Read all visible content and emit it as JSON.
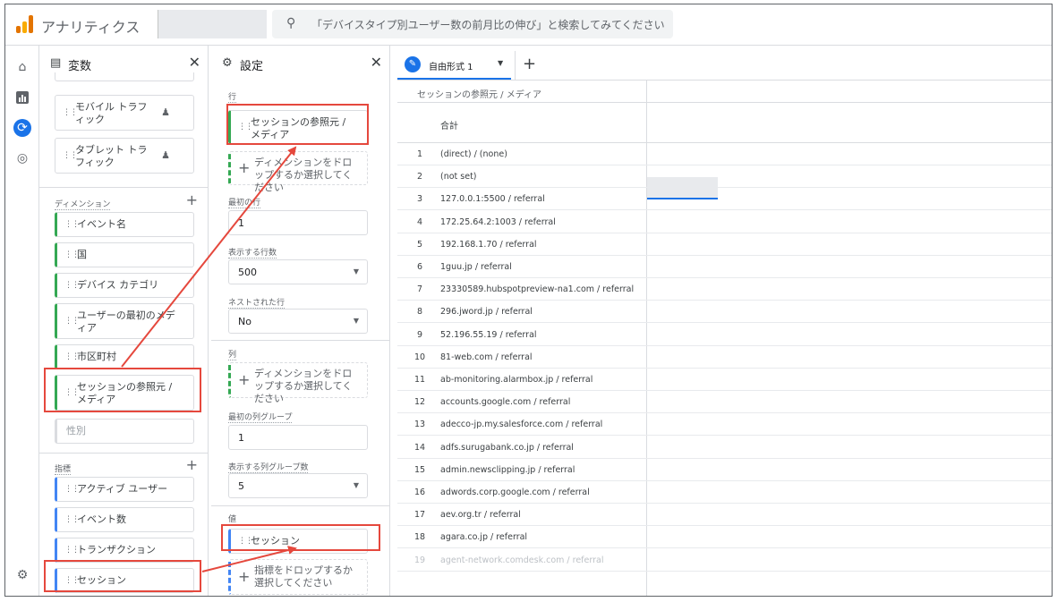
{
  "header": {
    "app_title": "アナリティクス",
    "search_placeholder": "「デバイスタイプ別ユーザー数の前月比の伸び」と検索してみてください"
  },
  "rail": {
    "icons": [
      "home-icon",
      "reports-icon",
      "explore-icon",
      "advertising-icon",
      "settings-icon"
    ]
  },
  "variables_panel": {
    "title": "変数",
    "top_chips": [
      "モバイル トラフィック",
      "タブレット トラフィック"
    ],
    "dimensions_label": "ディメンション",
    "dimensions": [
      "イベント名",
      "国",
      "デバイス カテゴリ",
      "ユーザーの最初のメディア",
      "市区町村",
      "セッションの参照元 / メディア",
      "性別"
    ],
    "metrics_label": "指標",
    "metrics": [
      "アクティブ ユーザー",
      "イベント数",
      "トランザクション",
      "セッション"
    ]
  },
  "settings_panel": {
    "title": "設定",
    "rows_label": "行",
    "row_chip": "セッションの参照元 / メディア",
    "drop_dimension": "ディメンションをドロップするか選択してください",
    "start_row_label": "最初の行",
    "start_row_value": "1",
    "show_rows_label": "表示する行数",
    "show_rows_value": "500",
    "nested_rows_label": "ネストされた行",
    "nested_rows_value": "No",
    "columns_label": "列",
    "drop_col_dimension": "ディメンションをドロップするか選択してください",
    "first_col_group_label": "最初の列グループ",
    "first_col_group_value": "1",
    "show_col_groups_label": "表示する列グループ数",
    "show_col_groups_value": "5",
    "values_label": "値",
    "value_chip": "セッション",
    "drop_metric": "指標をドロップするか選択してください"
  },
  "main": {
    "tab_label": "自由形式 1",
    "table": {
      "dimension_header": "セッションの参照元 / メディア",
      "total_label": "合計",
      "rows": [
        {
          "n": "1",
          "v": "(direct) / (none)"
        },
        {
          "n": "2",
          "v": "(not set)"
        },
        {
          "n": "3",
          "v": "127.0.0.1:5500 / referral"
        },
        {
          "n": "4",
          "v": "172.25.64.2:1003 / referral"
        },
        {
          "n": "5",
          "v": "192.168.1.70 / referral"
        },
        {
          "n": "6",
          "v": "1guu.jp / referral"
        },
        {
          "n": "7",
          "v": "23330589.hubspotpreview-na1.com / referral"
        },
        {
          "n": "8",
          "v": "296.jword.jp / referral"
        },
        {
          "n": "9",
          "v": "52.196.55.19 / referral"
        },
        {
          "n": "10",
          "v": "81-web.com / referral"
        },
        {
          "n": "11",
          "v": "ab-monitoring.alarmbox.jp / referral"
        },
        {
          "n": "12",
          "v": "accounts.google.com / referral"
        },
        {
          "n": "13",
          "v": "adecco-jp.my.salesforce.com / referral"
        },
        {
          "n": "14",
          "v": "adfs.surugabank.co.jp / referral"
        },
        {
          "n": "15",
          "v": "admin.newsclipping.jp / referral"
        },
        {
          "n": "16",
          "v": "adwords.corp.google.com / referral"
        },
        {
          "n": "17",
          "v": "aev.org.tr / referral"
        },
        {
          "n": "18",
          "v": "agara.co.jp / referral"
        },
        {
          "n": "19",
          "v": "agent-network.comdesk.com / referral"
        }
      ]
    }
  },
  "colors": {
    "accent": "#1a73e8",
    "highlight": "#e5483d",
    "dimension": "#34a853",
    "metric": "#4285f4"
  }
}
